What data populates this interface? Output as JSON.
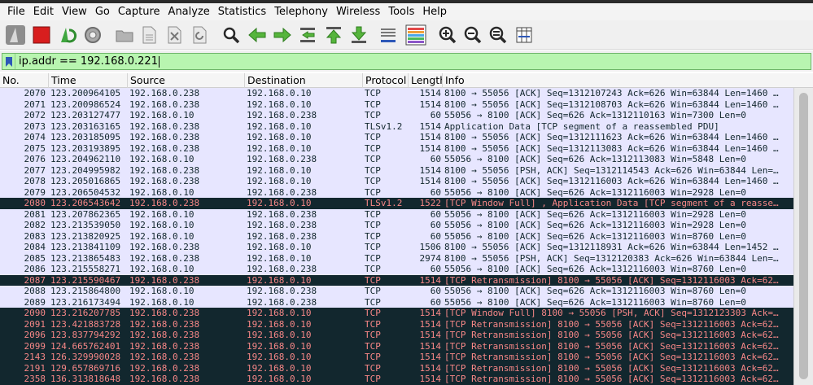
{
  "menu": [
    "File",
    "Edit",
    "View",
    "Go",
    "Capture",
    "Analyze",
    "Statistics",
    "Telephony",
    "Wireless",
    "Tools",
    "Help"
  ],
  "toolbar_icons": [
    "shark-fin-start-icon",
    "stop-square-icon",
    "restart-capture-icon",
    "capture-options-gear-icon",
    "open-folder-icon",
    "save-file-icon",
    "close-file-icon",
    "reload-file-icon",
    "find-packet-icon",
    "go-back-arrow-icon",
    "go-forward-arrow-icon",
    "go-to-packet-icon",
    "go-first-packet-icon",
    "go-last-packet-icon",
    "auto-scroll-icon",
    "colorize-icon",
    "zoom-in-icon",
    "zoom-out-icon",
    "zoom-normal-icon",
    "resize-columns-icon"
  ],
  "colors": {
    "normal_bg": "#e7e6ff",
    "dark_bg": "#12272e",
    "dark_fg": "#f78787",
    "filter_bg": "#b8f5b0"
  },
  "filter": {
    "value": "ip.addr == 192.168.0.221"
  },
  "columns": [
    "No.",
    "Time",
    "Source",
    "Destination",
    "Protocol",
    "Length",
    "Info"
  ],
  "packets": [
    {
      "no": "2070",
      "time": "123.200964105",
      "src": "192.168.0.238",
      "dst": "192.168.0.10",
      "proto": "TCP",
      "len": "1514",
      "info": "8100 → 55056 [ACK] Seq=1312107243 Ack=626 Win=63844 Len=1460 …",
      "style": "normal"
    },
    {
      "no": "2071",
      "time": "123.200986524",
      "src": "192.168.0.238",
      "dst": "192.168.0.10",
      "proto": "TCP",
      "len": "1514",
      "info": "8100 → 55056 [ACK] Seq=1312108703 Ack=626 Win=63844 Len=1460 …",
      "style": "normal"
    },
    {
      "no": "2072",
      "time": "123.203127477",
      "src": "192.168.0.10",
      "dst": "192.168.0.238",
      "proto": "TCP",
      "len": "60",
      "info": "55056 → 8100 [ACK] Seq=626 Ack=1312110163 Win=7300 Len=0",
      "style": "normal"
    },
    {
      "no": "2073",
      "time": "123.203163165",
      "src": "192.168.0.238",
      "dst": "192.168.0.10",
      "proto": "TLSv1.2",
      "len": "1514",
      "info": "Application Data [TCP segment of a reassembled PDU]",
      "style": "normal"
    },
    {
      "no": "2074",
      "time": "123.203185095",
      "src": "192.168.0.238",
      "dst": "192.168.0.10",
      "proto": "TCP",
      "len": "1514",
      "info": "8100 → 55056 [ACK] Seq=1312111623 Ack=626 Win=63844 Len=1460 …",
      "style": "normal"
    },
    {
      "no": "2075",
      "time": "123.203193895",
      "src": "192.168.0.238",
      "dst": "192.168.0.10",
      "proto": "TCP",
      "len": "1514",
      "info": "8100 → 55056 [ACK] Seq=1312113083 Ack=626 Win=63844 Len=1460 …",
      "style": "normal"
    },
    {
      "no": "2076",
      "time": "123.204962110",
      "src": "192.168.0.10",
      "dst": "192.168.0.238",
      "proto": "TCP",
      "len": "60",
      "info": "55056 → 8100 [ACK] Seq=626 Ack=1312113083 Win=5848 Len=0",
      "style": "normal"
    },
    {
      "no": "2077",
      "time": "123.204995982",
      "src": "192.168.0.238",
      "dst": "192.168.0.10",
      "proto": "TCP",
      "len": "1514",
      "info": "8100 → 55056 [PSH, ACK] Seq=1312114543 Ack=626 Win=63844 Len=…",
      "style": "normal"
    },
    {
      "no": "2078",
      "time": "123.205016865",
      "src": "192.168.0.238",
      "dst": "192.168.0.10",
      "proto": "TCP",
      "len": "1514",
      "info": "8100 → 55056 [ACK] Seq=1312116003 Ack=626 Win=63844 Len=1460 …",
      "style": "normal"
    },
    {
      "no": "2079",
      "time": "123.206504532",
      "src": "192.168.0.10",
      "dst": "192.168.0.238",
      "proto": "TCP",
      "len": "60",
      "info": "55056 → 8100 [ACK] Seq=626 Ack=1312116003 Win=2928 Len=0",
      "style": "normal"
    },
    {
      "no": "2080",
      "time": "123.206543642",
      "src": "192.168.0.238",
      "dst": "192.168.0.10",
      "proto": "TLSv1.2",
      "len": "1522",
      "info": "[TCP Window Full] , Application Data [TCP segment of a reasse…",
      "style": "dark"
    },
    {
      "no": "2081",
      "time": "123.207862365",
      "src": "192.168.0.10",
      "dst": "192.168.0.238",
      "proto": "TCP",
      "len": "60",
      "info": "55056 → 8100 [ACK] Seq=626 Ack=1312116003 Win=2928 Len=0",
      "style": "normal"
    },
    {
      "no": "2082",
      "time": "123.213539050",
      "src": "192.168.0.10",
      "dst": "192.168.0.238",
      "proto": "TCP",
      "len": "60",
      "info": "55056 → 8100 [ACK] Seq=626 Ack=1312116003 Win=2928 Len=0",
      "style": "normal"
    },
    {
      "no": "2083",
      "time": "123.213820925",
      "src": "192.168.0.10",
      "dst": "192.168.0.238",
      "proto": "TCP",
      "len": "60",
      "info": "55056 → 8100 [ACK] Seq=626 Ack=1312116003 Win=8760 Len=0",
      "style": "normal"
    },
    {
      "no": "2084",
      "time": "123.213841109",
      "src": "192.168.0.238",
      "dst": "192.168.0.10",
      "proto": "TCP",
      "len": "1506",
      "info": "8100 → 55056 [ACK] Seq=1312118931 Ack=626 Win=63844 Len=1452 …",
      "style": "normal"
    },
    {
      "no": "2085",
      "time": "123.213865483",
      "src": "192.168.0.238",
      "dst": "192.168.0.10",
      "proto": "TCP",
      "len": "2974",
      "info": "8100 → 55056 [PSH, ACK] Seq=1312120383 Ack=626 Win=63844 Len=…",
      "style": "normal"
    },
    {
      "no": "2086",
      "time": "123.215558271",
      "src": "192.168.0.10",
      "dst": "192.168.0.238",
      "proto": "TCP",
      "len": "60",
      "info": "55056 → 8100 [ACK] Seq=626 Ack=1312116003 Win=8760 Len=0",
      "style": "normal"
    },
    {
      "no": "2087",
      "time": "123.215590467",
      "src": "192.168.0.238",
      "dst": "192.168.0.10",
      "proto": "TCP",
      "len": "1514",
      "info": "[TCP Retransmission] 8100 → 55056 [ACK] Seq=1312116003 Ack=62…",
      "style": "dark"
    },
    {
      "no": "2088",
      "time": "123.215864800",
      "src": "192.168.0.10",
      "dst": "192.168.0.238",
      "proto": "TCP",
      "len": "60",
      "info": "55056 → 8100 [ACK] Seq=626 Ack=1312116003 Win=8760 Len=0",
      "style": "normal"
    },
    {
      "no": "2089",
      "time": "123.216173494",
      "src": "192.168.0.10",
      "dst": "192.168.0.238",
      "proto": "TCP",
      "len": "60",
      "info": "55056 → 8100 [ACK] Seq=626 Ack=1312116003 Win=8760 Len=0",
      "style": "normal"
    },
    {
      "no": "2090",
      "time": "123.216207785",
      "src": "192.168.0.238",
      "dst": "192.168.0.10",
      "proto": "TCP",
      "len": "1514",
      "info": "[TCP Window Full] 8100 → 55056 [PSH, ACK] Seq=1312123303 Ack=…",
      "style": "dark"
    },
    {
      "no": "2091",
      "time": "123.421883728",
      "src": "192.168.0.238",
      "dst": "192.168.0.10",
      "proto": "TCP",
      "len": "1514",
      "info": "[TCP Retransmission] 8100 → 55056 [ACK] Seq=1312116003 Ack=62…",
      "style": "dark"
    },
    {
      "no": "2096",
      "time": "123.837794292",
      "src": "192.168.0.238",
      "dst": "192.168.0.10",
      "proto": "TCP",
      "len": "1514",
      "info": "[TCP Retransmission] 8100 → 55056 [ACK] Seq=1312116003 Ack=62…",
      "style": "dark"
    },
    {
      "no": "2099",
      "time": "124.665762401",
      "src": "192.168.0.238",
      "dst": "192.168.0.10",
      "proto": "TCP",
      "len": "1514",
      "info": "[TCP Retransmission] 8100 → 55056 [ACK] Seq=1312116003 Ack=62…",
      "style": "dark"
    },
    {
      "no": "2143",
      "time": "126.329990028",
      "src": "192.168.0.238",
      "dst": "192.168.0.10",
      "proto": "TCP",
      "len": "1514",
      "info": "[TCP Retransmission] 8100 → 55056 [ACK] Seq=1312116003 Ack=62…",
      "style": "dark"
    },
    {
      "no": "2191",
      "time": "129.657869716",
      "src": "192.168.0.238",
      "dst": "192.168.0.10",
      "proto": "TCP",
      "len": "1514",
      "info": "[TCP Retransmission] 8100 → 55056 [ACK] Seq=1312116003 Ack=62…",
      "style": "dark"
    },
    {
      "no": "2358",
      "time": "136.313818648",
      "src": "192.168.0.238",
      "dst": "192.168.0.10",
      "proto": "TCP",
      "len": "1514",
      "info": "[TCP Retransmission] 8100 → 55056 [ACK] Seq=1312116003 Ack=62…",
      "style": "dark"
    }
  ]
}
